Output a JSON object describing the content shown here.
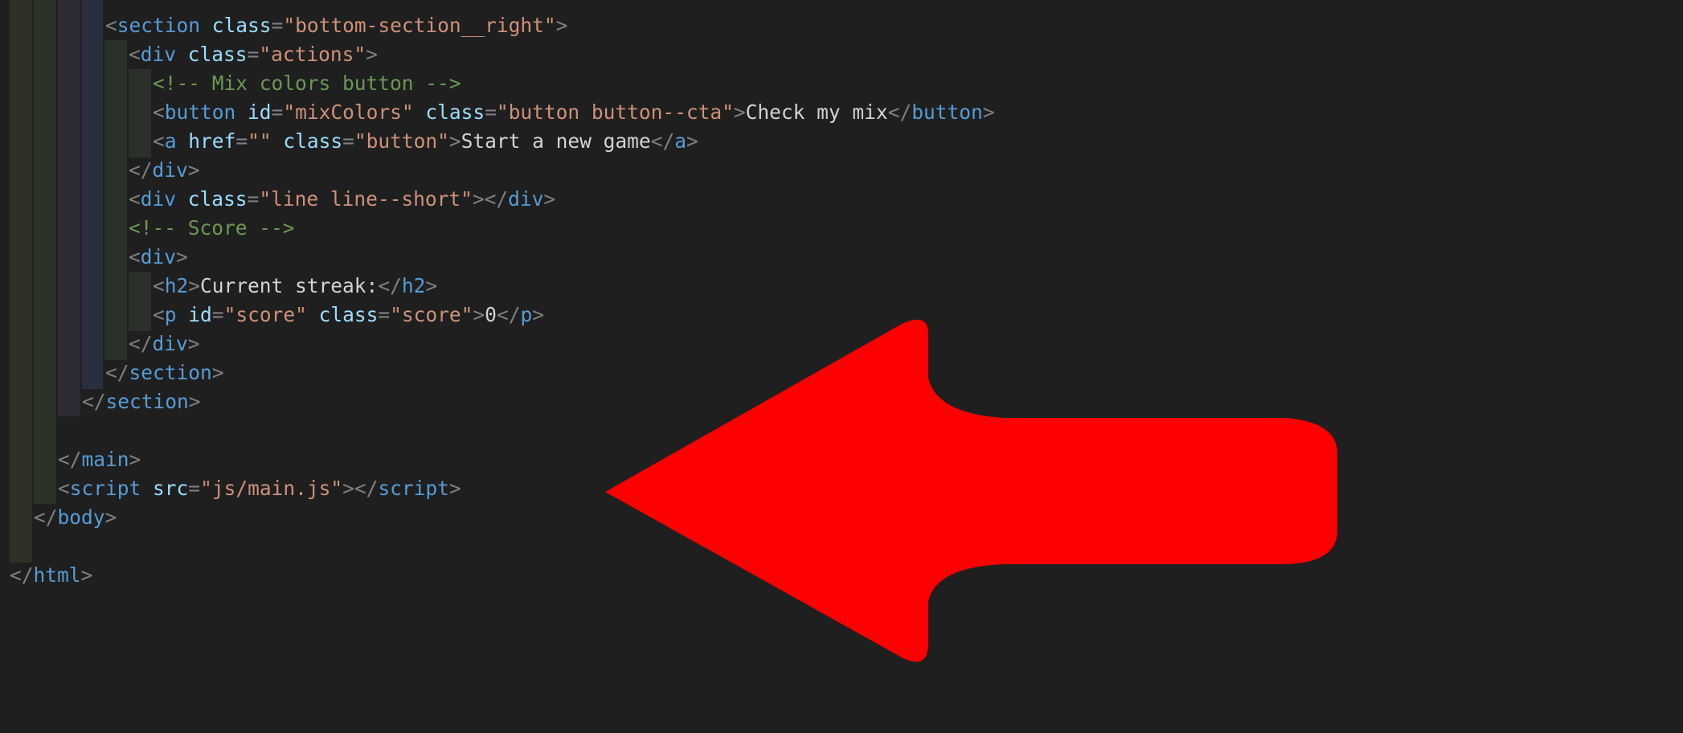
{
  "editor": {
    "lines": [
      {
        "tokens": [
          [
            "t",
            "<"
          ],
          [
            "tag",
            "section"
          ],
          [
            "txt",
            " "
          ],
          [
            "attr",
            "class"
          ],
          [
            "t",
            "="
          ],
          [
            "str",
            "\"bottom-section__right\""
          ],
          [
            "t",
            ">"
          ]
        ]
      },
      {
        "tokens": [
          [
            "t",
            "<"
          ],
          [
            "tag",
            "div"
          ],
          [
            "txt",
            " "
          ],
          [
            "attr",
            "class"
          ],
          [
            "t",
            "="
          ],
          [
            "str",
            "\"actions\""
          ],
          [
            "t",
            ">"
          ]
        ]
      },
      {
        "tokens": [
          [
            "cm",
            "<!-- Mix colors button -->"
          ]
        ]
      },
      {
        "tokens": [
          [
            "t",
            "<"
          ],
          [
            "tag",
            "button"
          ],
          [
            "txt",
            " "
          ],
          [
            "attr",
            "id"
          ],
          [
            "t",
            "="
          ],
          [
            "str",
            "\"mixColors\""
          ],
          [
            "txt",
            " "
          ],
          [
            "attr",
            "class"
          ],
          [
            "t",
            "="
          ],
          [
            "str",
            "\"button button--cta\""
          ],
          [
            "t",
            ">"
          ],
          [
            "txt",
            "Check my mix"
          ],
          [
            "t",
            "</"
          ],
          [
            "tag",
            "button"
          ],
          [
            "t",
            ">"
          ]
        ]
      },
      {
        "tokens": [
          [
            "t",
            "<"
          ],
          [
            "tag",
            "a"
          ],
          [
            "txt",
            " "
          ],
          [
            "attr",
            "href"
          ],
          [
            "t",
            "="
          ],
          [
            "str",
            "\"\""
          ],
          [
            "txt",
            " "
          ],
          [
            "attr",
            "class"
          ],
          [
            "t",
            "="
          ],
          [
            "str",
            "\"button\""
          ],
          [
            "t",
            ">"
          ],
          [
            "txt",
            "Start a new game"
          ],
          [
            "t",
            "</"
          ],
          [
            "tag",
            "a"
          ],
          [
            "t",
            ">"
          ]
        ]
      },
      {
        "tokens": [
          [
            "t",
            "</"
          ],
          [
            "tag",
            "div"
          ],
          [
            "t",
            ">"
          ]
        ]
      },
      {
        "tokens": [
          [
            "t",
            "<"
          ],
          [
            "tag",
            "div"
          ],
          [
            "txt",
            " "
          ],
          [
            "attr",
            "class"
          ],
          [
            "t",
            "="
          ],
          [
            "str",
            "\"line line--short\""
          ],
          [
            "t",
            ">"
          ],
          [
            "t",
            "</"
          ],
          [
            "tag",
            "div"
          ],
          [
            "t",
            ">"
          ]
        ]
      },
      {
        "tokens": [
          [
            "cm",
            "<!-- Score -->"
          ]
        ]
      },
      {
        "tokens": [
          [
            "t",
            "<"
          ],
          [
            "tag",
            "div"
          ],
          [
            "t",
            ">"
          ]
        ]
      },
      {
        "tokens": [
          [
            "t",
            "<"
          ],
          [
            "tag",
            "h2"
          ],
          [
            "t",
            ">"
          ],
          [
            "txt",
            "Current streak:"
          ],
          [
            "t",
            "</"
          ],
          [
            "tag",
            "h2"
          ],
          [
            "t",
            ">"
          ]
        ]
      },
      {
        "tokens": [
          [
            "t",
            "<"
          ],
          [
            "tag",
            "p"
          ],
          [
            "txt",
            " "
          ],
          [
            "attr",
            "id"
          ],
          [
            "t",
            "="
          ],
          [
            "str",
            "\"score\""
          ],
          [
            "txt",
            " "
          ],
          [
            "attr",
            "class"
          ],
          [
            "t",
            "="
          ],
          [
            "str",
            "\"score\""
          ],
          [
            "t",
            ">"
          ],
          [
            "txt",
            "0"
          ],
          [
            "t",
            "</"
          ],
          [
            "tag",
            "p"
          ],
          [
            "t",
            ">"
          ]
        ]
      },
      {
        "tokens": [
          [
            "t",
            "</"
          ],
          [
            "tag",
            "div"
          ],
          [
            "t",
            ">"
          ]
        ]
      },
      {
        "tokens": [
          [
            "t",
            "</"
          ],
          [
            "tag",
            "section"
          ],
          [
            "t",
            ">"
          ]
        ]
      },
      {
        "tokens": [
          [
            "t",
            "</"
          ],
          [
            "tag",
            "section"
          ],
          [
            "t",
            ">"
          ]
        ]
      },
      {
        "tokens": []
      },
      {
        "tokens": [
          [
            "t",
            "</"
          ],
          [
            "tag",
            "main"
          ],
          [
            "t",
            ">"
          ]
        ]
      },
      {
        "tokens": [
          [
            "t",
            "<"
          ],
          [
            "tag",
            "script"
          ],
          [
            "txt",
            " "
          ],
          [
            "attr",
            "src"
          ],
          [
            "t",
            "="
          ],
          [
            "str",
            "\"js/main.js\""
          ],
          [
            "t",
            ">"
          ],
          [
            "t",
            "</"
          ],
          [
            "tag",
            "script"
          ],
          [
            "t",
            ">"
          ]
        ]
      },
      {
        "tokens": [
          [
            "t",
            "</"
          ],
          [
            "tag",
            "body"
          ],
          [
            "t",
            ">"
          ]
        ]
      },
      {
        "tokens": []
      },
      {
        "tokens": [
          [
            "t",
            "</"
          ],
          [
            "tag",
            "html"
          ],
          [
            "t",
            ">"
          ]
        ]
      }
    ]
  },
  "annotation": {
    "shape": "arrow-left-icon",
    "color": "#ff0000"
  }
}
